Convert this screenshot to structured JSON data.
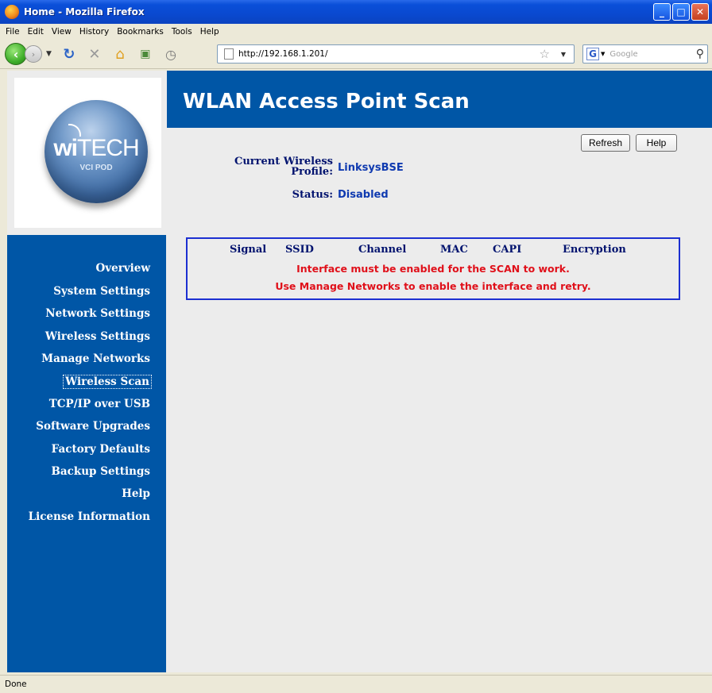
{
  "window": {
    "title": "Home - Mozilla Firefox"
  },
  "menubar": {
    "items": [
      "File",
      "Edit",
      "View",
      "History",
      "Bookmarks",
      "Tools",
      "Help"
    ]
  },
  "navbar": {
    "url": "http://192.168.1.201/",
    "search_placeholder": "Google"
  },
  "logo": {
    "brand_prefix": "wi",
    "brand_suffix": "TECH",
    "subtitle": "VCI POD"
  },
  "sidebar": {
    "items": [
      {
        "label": "Overview"
      },
      {
        "label": "System Settings"
      },
      {
        "label": "Network Settings"
      },
      {
        "label": "Wireless Settings"
      },
      {
        "label": "Manage Networks"
      },
      {
        "label": "Wireless Scan",
        "active": true
      },
      {
        "label": "TCP/IP over USB"
      },
      {
        "label": "Software Upgrades"
      },
      {
        "label": "Factory Defaults"
      },
      {
        "label": "Backup Settings"
      },
      {
        "label": "Help"
      },
      {
        "label": "License Information"
      }
    ]
  },
  "page": {
    "title": "WLAN Access Point Scan",
    "refresh_label": "Refresh",
    "help_label": "Help",
    "profile_label_line1": "Current Wireless",
    "profile_label_line2": "Profile:",
    "profile_value": "LinksysBSE",
    "status_label": "Status:",
    "status_value": "Disabled"
  },
  "scan_table": {
    "columns": [
      "Signal",
      "SSID",
      "Channel",
      "MAC",
      "CAPI",
      "Encryption"
    ],
    "messages": [
      "Interface must be enabled for the SCAN to work.",
      "Use Manage Networks to enable the interface and retry."
    ]
  },
  "statusbar": {
    "text": "Done"
  }
}
